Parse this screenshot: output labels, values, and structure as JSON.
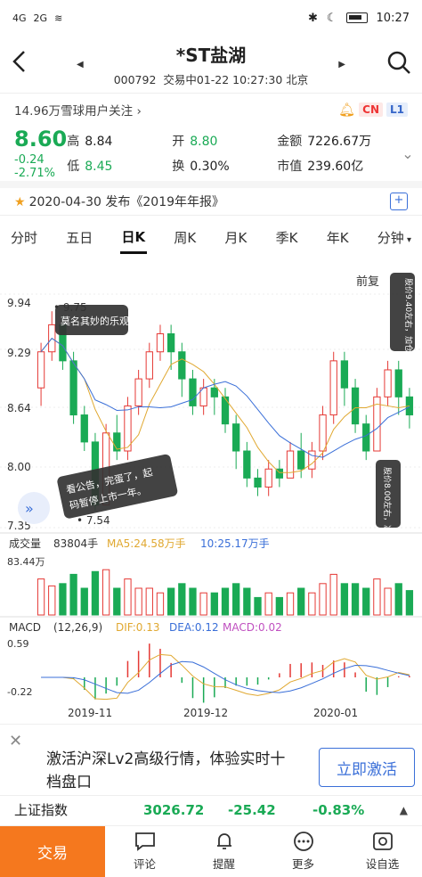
{
  "status_bar": {
    "signal1": "4G",
    "signal2": "2G",
    "time": "10:27"
  },
  "nav": {
    "title": "*ST盐湖",
    "code": "000792",
    "status": "交易中01-22 10:27:30 北京"
  },
  "followers": {
    "text": "14.96万雪球用户关注",
    "badge_cn": "CN",
    "badge_l1": "L1"
  },
  "quote": {
    "price": "8.60",
    "change": "-0.24",
    "change_pct": "-2.71%",
    "high_label": "高",
    "high": "8.84",
    "low_label": "低",
    "low": "8.45",
    "open_label": "开",
    "open": "8.80",
    "turnover_label": "换",
    "turnover": "0.30%",
    "amount_label": "金额",
    "amount": "7226.67万",
    "mcap_label": "市值",
    "mcap": "239.60亿"
  },
  "report": {
    "text": "2020-04-30 发布《2019年年报》"
  },
  "tabs": [
    "分时",
    "五日",
    "日K",
    "周K",
    "月K",
    "季K",
    "年K",
    "分钟"
  ],
  "active_tab": "日K",
  "chart": {
    "adjust_label": "前复",
    "price_axis": [
      "9.94",
      "9.29",
      "8.64",
      "8.00",
      "7.35"
    ],
    "high_mark": "9.75",
    "low_mark": "7.54",
    "bubble1": "莫名其妙的乐观",
    "bubble2": "看公告，完蛋了，起码暂停上市一年。",
    "bubble3": "股价9.40左右，加仓了。",
    "bubble4": "股价8.00左右，减仓了。",
    "volume_label": "成交量",
    "volume_value": "83804手",
    "ma5_label": "MA5:24.58万手",
    "ma10_label": "10:25.17万手",
    "volume_axis": "83.44万",
    "macd_label": "MACD",
    "macd_params": "(12,26,9)",
    "dif": "DIF:0.13",
    "dea": "DEA:0.12",
    "macd_val": "MACD:0.02",
    "macd_axis_top": "0.59",
    "macd_axis_bottom": "-0.22",
    "x_axis": [
      "2019-11",
      "2019-12",
      "2020-01"
    ],
    "colors": {
      "up": "#e53935",
      "down": "#1aaa55",
      "ma5": "#e0a830",
      "ma10": "#3a6fd8"
    }
  },
  "chart_data": {
    "type": "candlestick",
    "ylim": [
      7.35,
      9.94
    ],
    "x": [
      "2019-11",
      "2019-12",
      "2020-01"
    ],
    "candles": [
      [
        8.9,
        9.3,
        9.4,
        8.7
      ],
      [
        9.3,
        9.6,
        9.75,
        9.2
      ],
      [
        9.6,
        9.2,
        9.7,
        9.1
      ],
      [
        9.2,
        8.6,
        9.3,
        8.5
      ],
      [
        8.6,
        8.3,
        8.7,
        8.2
      ],
      [
        8.3,
        7.6,
        8.4,
        7.54
      ],
      [
        7.6,
        8.4,
        8.5,
        7.6
      ],
      [
        8.4,
        8.2,
        8.6,
        8.1
      ],
      [
        8.2,
        8.7,
        8.8,
        8.1
      ],
      [
        8.7,
        9.0,
        9.1,
        8.6
      ],
      [
        9.0,
        9.3,
        9.4,
        8.9
      ],
      [
        9.3,
        9.5,
        9.6,
        9.2
      ],
      [
        9.5,
        9.3,
        9.6,
        9.1
      ],
      [
        9.3,
        9.0,
        9.4,
        8.8
      ],
      [
        9.0,
        8.7,
        9.1,
        8.6
      ],
      [
        8.7,
        8.9,
        9.0,
        8.6
      ],
      [
        8.9,
        8.8,
        9.0,
        8.6
      ],
      [
        8.8,
        8.5,
        8.9,
        8.4
      ],
      [
        8.5,
        8.2,
        8.6,
        8.0
      ],
      [
        8.2,
        7.9,
        8.3,
        7.8
      ],
      [
        7.9,
        7.8,
        8.0,
        7.7
      ],
      [
        7.8,
        8.0,
        8.1,
        7.7
      ],
      [
        8.0,
        7.9,
        8.1,
        7.8
      ],
      [
        7.9,
        8.2,
        8.3,
        7.9
      ],
      [
        8.2,
        8.0,
        8.4,
        7.9
      ],
      [
        8.0,
        8.2,
        8.3,
        7.9
      ],
      [
        8.2,
        8.6,
        8.7,
        8.1
      ],
      [
        8.6,
        9.2,
        9.3,
        8.5
      ],
      [
        9.2,
        8.9,
        9.3,
        8.7
      ],
      [
        8.9,
        8.5,
        9.0,
        8.4
      ],
      [
        8.5,
        8.2,
        8.6,
        8.1
      ],
      [
        8.2,
        8.8,
        8.9,
        8.2
      ],
      [
        8.8,
        9.1,
        9.2,
        8.7
      ],
      [
        9.1,
        8.8,
        9.2,
        8.6
      ],
      [
        8.8,
        8.6,
        8.9,
        8.45
      ]
    ]
  }
}
